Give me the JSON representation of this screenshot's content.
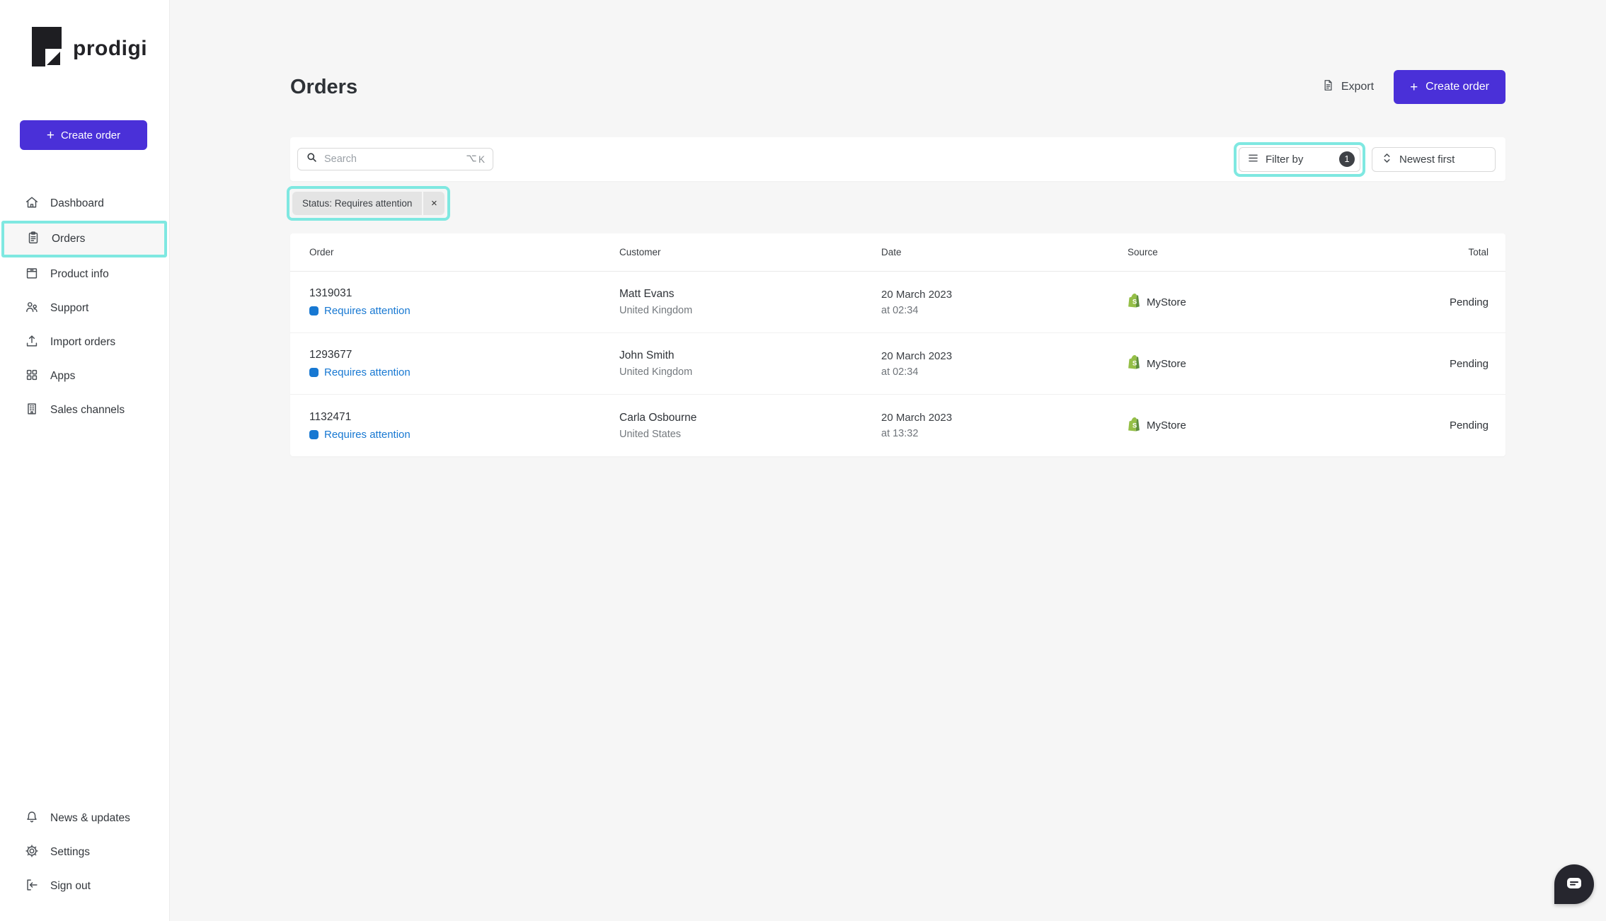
{
  "brand": {
    "name": "prodigi"
  },
  "sidebar": {
    "create_order": "Create order",
    "items": [
      {
        "label": "Dashboard"
      },
      {
        "label": "Orders"
      },
      {
        "label": "Product info"
      },
      {
        "label": "Support"
      },
      {
        "label": "Import orders"
      },
      {
        "label": "Apps"
      },
      {
        "label": "Sales channels"
      }
    ],
    "footer_items": [
      {
        "label": "News & updates"
      },
      {
        "label": "Settings"
      },
      {
        "label": "Sign out"
      }
    ]
  },
  "header": {
    "title": "Orders",
    "export": "Export",
    "create_order": "Create order"
  },
  "toolbar": {
    "search_placeholder": "Search",
    "search_shortcut": "⌥K",
    "search_shortcut_key": "K",
    "filter_label": "Filter by",
    "filter_count": "1",
    "sort_label": "Newest first"
  },
  "filter_chip": {
    "label": "Status: Requires attention",
    "remove": "×"
  },
  "table": {
    "columns": {
      "order": "Order",
      "customer": "Customer",
      "date": "Date",
      "source": "Source",
      "total": "Total"
    },
    "rows": [
      {
        "id": "1319031",
        "status": "Requires attention",
        "customer": "Matt Evans",
        "country": "United Kingdom",
        "date": "20 March 2023",
        "time": "at 02:34",
        "source": "MyStore",
        "total": "Pending"
      },
      {
        "id": "1293677",
        "status": "Requires attention",
        "customer": "John Smith",
        "country": "United Kingdom",
        "date": "20 March 2023",
        "time": "at 02:34",
        "source": "MyStore",
        "total": "Pending"
      },
      {
        "id": "1132471",
        "status": "Requires attention",
        "customer": "Carla Osbourne",
        "country": "United States",
        "date": "20 March 2023",
        "time": "at 13:32",
        "source": "MyStore",
        "total": "Pending"
      }
    ]
  },
  "colors": {
    "accent_purple": "#4A30D8",
    "highlight_cyan": "#7FE8E1",
    "status_blue": "#1778D2",
    "shopify_green": "#95BF47",
    "chat_fab": "#26262E"
  }
}
